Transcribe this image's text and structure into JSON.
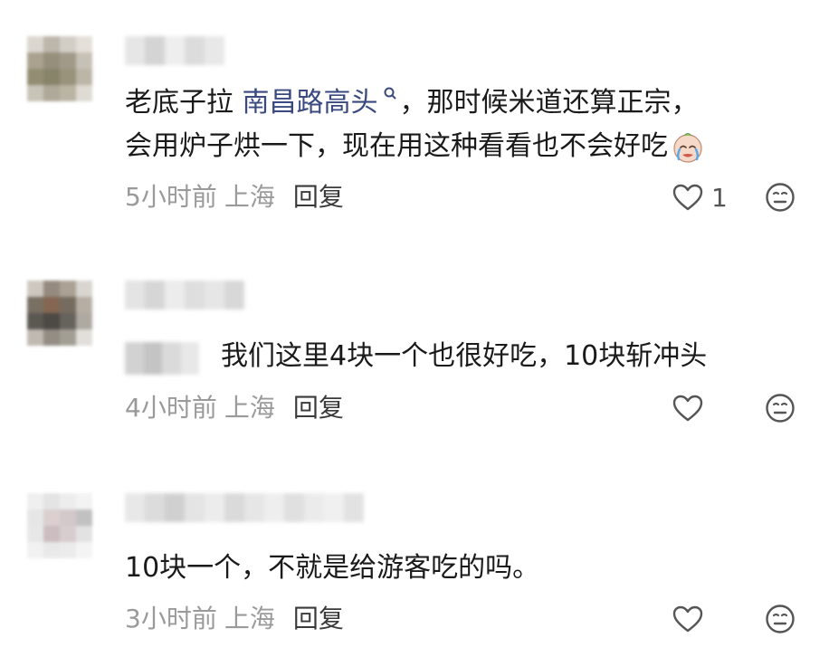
{
  "comments": [
    {
      "text_prefix": "老底子拉 ",
      "link_text": "南昌路高头",
      "text_suffix_line1": "，那时候米道还算正宗，",
      "text_line2": "会用炉子烘一下，现在用这种看看也不会好吃",
      "emoji": "crying-face-emoji",
      "time": "5小时前",
      "location": "上海",
      "reply_label": "回复",
      "like_count": "1"
    },
    {
      "text": "我们这里4块一个也很好吃，10块斩冲头",
      "time": "4小时前",
      "location": "上海",
      "reply_label": "回复"
    },
    {
      "text": "10块一个，不就是给游客吃的吗。",
      "time": "3小时前",
      "location": "上海",
      "reply_label": "回复"
    }
  ],
  "icons": {
    "like": "heart-outline-icon",
    "dislike": "neutral-face-icon",
    "link_search": "search-icon"
  },
  "colors": {
    "text": "#1a1a1a",
    "meta": "#9a9a9a",
    "link": "#3a4a80",
    "reply": "#3a3a3a"
  }
}
